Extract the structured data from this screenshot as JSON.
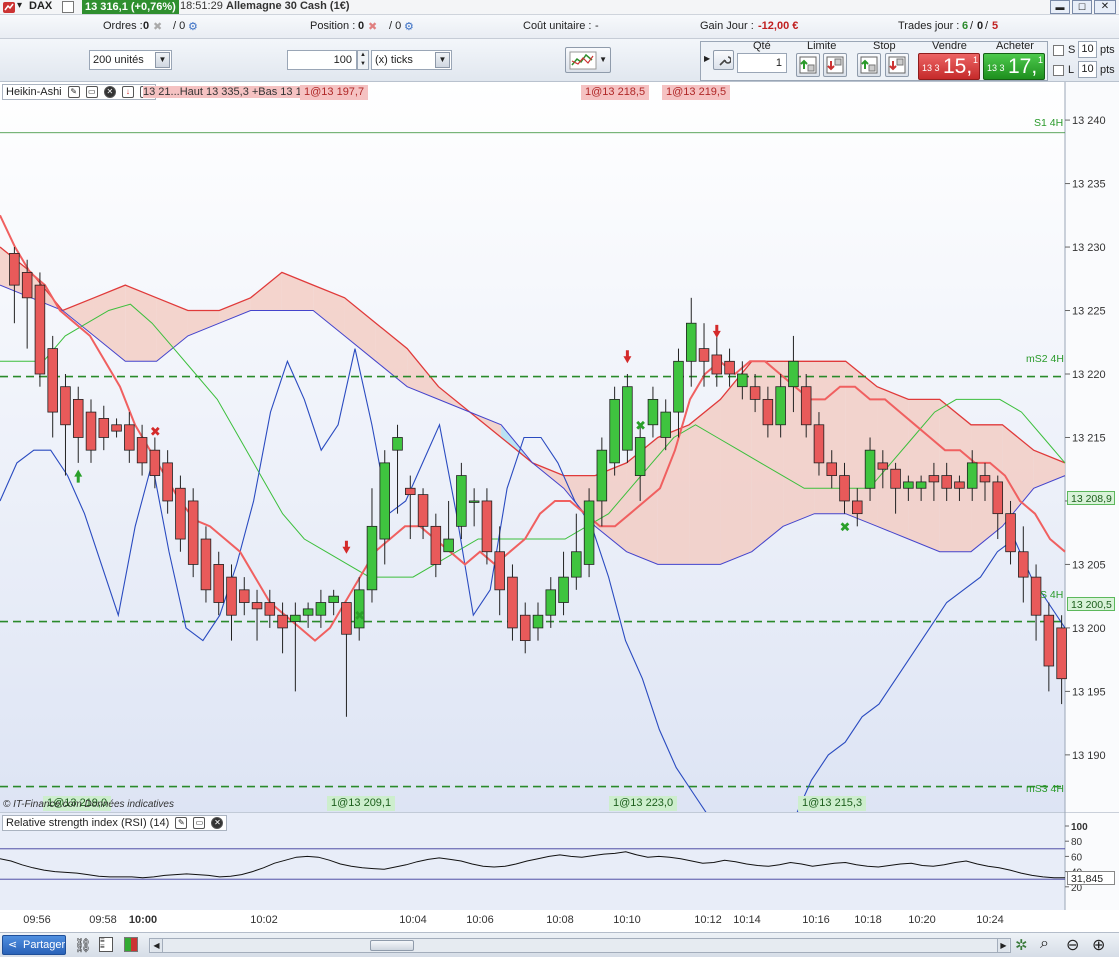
{
  "titlebar": {
    "instrument": "DAX",
    "quote": "13 316,1 (+0,76%)",
    "time": "18:51:29",
    "description": "Allemagne 30 Cash (1€)"
  },
  "infobar": {
    "orders_label": "Ordres :",
    "orders_count": "0",
    "orders_sep": "/ 0",
    "position_label": "Position :",
    "position_count": "0",
    "position_sep": "/ 0",
    "unit_cost_label": "Coût unitaire :",
    "unit_cost_value": "-",
    "day_gain_label": "Gain Jour :",
    "day_gain_value": "-12,00 €",
    "trades_label": "Trades jour :",
    "trades_a": "6",
    "trades_b": "0",
    "trades_c": "5",
    "slash": "/"
  },
  "toolbar": {
    "units_value": "200 unités",
    "ticks_qty": "100",
    "ticks_unit": "(x) ticks",
    "qty_header": "Qté",
    "qty_value": "1",
    "limit_label": "Limite",
    "stop_label": "Stop",
    "sell_label": "Vendre",
    "buy_label": "Acheter",
    "sell_small": "13 3",
    "sell_big": "15,",
    "sell_sup": "1",
    "buy_small": "13 3",
    "buy_big": "17,",
    "buy_sup": "1",
    "s_label": "S",
    "l_label": "L",
    "s_pts": "10",
    "l_pts": "10",
    "pts": "pts"
  },
  "indicator_label": "Heikin-Ashi",
  "legend_text": "13 21...Haut 13 335,3 +Bas 13 164",
  "chart_tags": {
    "top": [
      "1@13 197,7",
      "1@13 218,5",
      "1@13 219,5"
    ],
    "bottom": [
      "1@13 219,0",
      "1@13 209,1",
      "1@13 223,0",
      "1@13 215,3"
    ]
  },
  "level_labels": {
    "s1": "S1 4H",
    "ms2": "mS2 4H",
    "s_mid": "S 4H",
    "ms3": "mS3 4H"
  },
  "price_tags": {
    "p1": "13 208,9",
    "p2": "13 200,5"
  },
  "copyright": "© IT-Finance.com  Données indicatives",
  "rsi": {
    "label": "Relative strength index (RSI) (14)",
    "value_tag": "31,845",
    "levels": [
      "100",
      "80",
      "60",
      "40",
      "20"
    ],
    "values": [
      57,
      54,
      49,
      45,
      42,
      40,
      39,
      38,
      36,
      34,
      33,
      33,
      33,
      32,
      33,
      35,
      36,
      37,
      36,
      35,
      33,
      34,
      36,
      40,
      45,
      51,
      55,
      59,
      60,
      59,
      55,
      50,
      47,
      45,
      44,
      43,
      46,
      49,
      53,
      56,
      58,
      56,
      54,
      50,
      47,
      46,
      47,
      50,
      54,
      57,
      60,
      62,
      60,
      59,
      61,
      63,
      64,
      66,
      62,
      59,
      60,
      59,
      57,
      54,
      51,
      52,
      55,
      53,
      50,
      48,
      47,
      49,
      52,
      50,
      47,
      49,
      51,
      52,
      49,
      47,
      46,
      48,
      50,
      51,
      48,
      47,
      49,
      52,
      54,
      50,
      47,
      45,
      42,
      38,
      35,
      33,
      32,
      32
    ]
  },
  "xaxis": [
    "09:56",
    "09:58",
    "10:00",
    "10:02",
    "10:04",
    "10:06",
    "10:08",
    "10:10",
    "10:12",
    "10:14",
    "10:16",
    "10:18",
    "10:20",
    "10:24"
  ],
  "bottombar": {
    "share_label": "Partager"
  },
  "chart_data": {
    "type": "candlestick",
    "y_ticks": [
      "13 240",
      "13 235",
      "13 230",
      "13 225",
      "13 220",
      "13 215",
      "13 210",
      "13 205",
      "13 200",
      "13 195",
      "13 190"
    ],
    "ylim": [
      13185.5,
      13243
    ],
    "candles": [
      [
        13229.5,
        13227,
        13230,
        13224
      ],
      [
        13228,
        13226,
        13229,
        13222
      ],
      [
        13227,
        13220,
        13228,
        13219
      ],
      [
        13222,
        13217,
        13223,
        13215
      ],
      [
        13219,
        13216,
        13220,
        13212
      ],
      [
        13218,
        13215,
        13219,
        13213
      ],
      [
        13217,
        13214,
        13218,
        13213
      ],
      [
        13216.5,
        13215,
        13217.5,
        13214
      ],
      [
        13216,
        13215.5,
        13216.5,
        13215
      ],
      [
        13216,
        13214,
        13217,
        13213
      ],
      [
        13215,
        13213,
        13216,
        13212
      ],
      [
        13214,
        13212,
        13215,
        13211
      ],
      [
        13213,
        13210,
        13214,
        13209
      ],
      [
        13211,
        13207,
        13212,
        13206
      ],
      [
        13210,
        13205,
        13211,
        13204
      ],
      [
        13207,
        13203,
        13208,
        13202
      ],
      [
        13205,
        13202,
        13206,
        13201
      ],
      [
        13204,
        13201,
        13205,
        13199
      ],
      [
        13203,
        13202,
        13204,
        13201
      ],
      [
        13202,
        13201.5,
        13203,
        13199
      ],
      [
        13202,
        13201,
        13203,
        13200
      ],
      [
        13201,
        13200,
        13202,
        13198
      ],
      [
        13200.5,
        13201,
        13202,
        13195
      ],
      [
        13201,
        13201.5,
        13202,
        13200
      ],
      [
        13201,
        13202,
        13203,
        13200
      ],
      [
        13202,
        13202.5,
        13203,
        13201
      ],
      [
        13202,
        13199.5,
        13202,
        13193
      ],
      [
        13200,
        13203,
        13204,
        13199
      ],
      [
        13203,
        13208,
        13211,
        13202
      ],
      [
        13207,
        13213,
        13214,
        13205
      ],
      [
        13214,
        13215,
        13216,
        13209
      ],
      [
        13211,
        13210.5,
        13212,
        13207
      ],
      [
        13210.5,
        13208,
        13211,
        13207
      ],
      [
        13208,
        13205,
        13209,
        13204
      ],
      [
        13206,
        13207,
        13210,
        13206
      ],
      [
        13208,
        13212,
        13213,
        13207
      ],
      [
        13210,
        13210,
        13211,
        13208
      ],
      [
        13210,
        13206,
        13211,
        13205
      ],
      [
        13206,
        13203,
        13208,
        13201
      ],
      [
        13204,
        13200,
        13205,
        13199
      ],
      [
        13201,
        13199,
        13202,
        13198
      ],
      [
        13200,
        13201,
        13202,
        13199
      ],
      [
        13201,
        13203,
        13204,
        13200
      ],
      [
        13202,
        13204,
        13206,
        13201
      ],
      [
        13204,
        13206,
        13209,
        13203
      ],
      [
        13205,
        13210,
        13211,
        13204
      ],
      [
        13210,
        13214,
        13215,
        13208
      ],
      [
        13213,
        13218,
        13219,
        13212
      ],
      [
        13214,
        13219,
        13220,
        13213
      ],
      [
        13212,
        13215,
        13216,
        13210
      ],
      [
        13216,
        13218,
        13219,
        13215
      ],
      [
        13215,
        13217,
        13218,
        13214
      ],
      [
        13217,
        13221,
        13222,
        13215
      ],
      [
        13221,
        13224,
        13226,
        13219
      ],
      [
        13222,
        13221,
        13224,
        13219
      ],
      [
        13221.5,
        13220,
        13223,
        13219
      ],
      [
        13221,
        13220,
        13222,
        13219
      ],
      [
        13219,
        13220,
        13221,
        13218
      ],
      [
        13219,
        13218,
        13220,
        13217
      ],
      [
        13218,
        13216,
        13219,
        13215
      ],
      [
        13216,
        13219,
        13220,
        13215
      ],
      [
        13219,
        13221,
        13223,
        13217
      ],
      [
        13219,
        13216,
        13220,
        13215
      ],
      [
        13216,
        13213,
        13217,
        13212
      ],
      [
        13213,
        13212,
        13214,
        13211
      ],
      [
        13212,
        13210,
        13213,
        13209
      ],
      [
        13210,
        13209,
        13211,
        13208
      ],
      [
        13211,
        13214,
        13215,
        13210
      ],
      [
        13213,
        13212.5,
        13214,
        13211
      ],
      [
        13212.5,
        13211,
        13213,
        13209
      ],
      [
        13211,
        13211.5,
        13212,
        13210
      ],
      [
        13211,
        13211.5,
        13212,
        13210
      ],
      [
        13212,
        13211.5,
        13213,
        13210
      ],
      [
        13212,
        13211,
        13213,
        13210
      ],
      [
        13211.5,
        13211,
        13212,
        13210
      ],
      [
        13211,
        13213,
        13214,
        13210
      ],
      [
        13212,
        13211.5,
        13213,
        13210
      ],
      [
        13211.5,
        13209,
        13212,
        13207
      ],
      [
        13209,
        13206,
        13210,
        13205
      ],
      [
        13206,
        13204,
        13208,
        13202
      ],
      [
        13204,
        13201,
        13205,
        13199
      ],
      [
        13201,
        13197,
        13202,
        13195
      ],
      [
        13200,
        13196,
        13201,
        13194
      ]
    ],
    "line_red": [
      13232.5,
      13230,
      13228,
      13227,
      13225,
      13224,
      13223,
      13221,
      13219,
      13216,
      13214,
      13212,
      13210,
      13208.5,
      13208,
      13207,
      13206,
      13204,
      13202,
      13201,
      13200,
      13199,
      13200,
      13202,
      13204,
      13206,
      13207,
      13208,
      13208,
      13207,
      13206,
      13205,
      13206,
      13205,
      13206,
      13207,
      13209,
      13210,
      13210,
      13209,
      13208,
      13208,
      13209,
      13210,
      13211,
      13214,
      13218,
      13220,
      13221,
      13220,
      13221,
      13221,
      13220,
      13219,
      13218,
      13218,
      13219,
      13219,
      13218,
      13218,
      13217,
      13216,
      13215,
      13214,
      13214,
      13213,
      13213,
      13212,
      13210,
      13209,
      13207,
      13206
    ],
    "line_blue": [
      13210,
      13213,
      13214,
      13214,
      13212,
      13209,
      13205,
      13201,
      13208,
      13213,
      13206,
      13200,
      13199,
      13201,
      13205,
      13210,
      13217,
      13221,
      13218,
      13214,
      13216,
      13222,
      13216,
      13209,
      13210,
      13213,
      13216,
      13209,
      13201,
      13203,
      13211,
      13215,
      13215,
      13213,
      13210,
      13208,
      13204,
      13199,
      13196,
      13192,
      13189,
      13187,
      13185,
      13183,
      13182,
      13182,
      13183,
      13185,
      13188,
      13190,
      13191,
      13193,
      13194,
      13196,
      13198,
      13200,
      13202,
      13203,
      13204,
      13206,
      13207,
      13204,
      13202,
      13200
    ],
    "line_green_a": [
      13221,
      13221,
      13221,
      13223,
      13224,
      13225,
      13225.5,
      13224,
      13222,
      13220,
      13218,
      13215,
      13212,
      13209,
      13207,
      13206,
      13205,
      13204,
      13204,
      13204,
      13205,
      13206,
      13207,
      13207,
      13207,
      13207,
      13207,
      13208,
      13209,
      13211,
      13213,
      13215,
      13216,
      13215,
      13214,
      13213,
      13212,
      13211,
      13211,
      13211,
      13211,
      13213,
      13215,
      13217,
      13218,
      13218,
      13218,
      13217,
      13215,
      13213
    ],
    "cloud_top": [
      13230,
      13228,
      13225,
      13226,
      13227,
      13226,
      13225,
      13225,
      13226,
      13228,
      13227,
      13226,
      13224,
      13222,
      13219,
      13217,
      13215,
      13213,
      13212,
      13212,
      13213,
      13215,
      13216,
      13218,
      13221,
      13221,
      13221,
      13221,
      13219,
      13218,
      13218,
      13216,
      13216,
      13214,
      13213
    ],
    "cloud_bottom": [
      13227,
      13226,
      13225,
      13223,
      13221,
      13221,
      13223,
      13224,
      13225,
      13225,
      13225,
      13223,
      13221,
      13219,
      13218,
      13217,
      13216,
      13213,
      13211,
      13208,
      13206,
      13205,
      13205,
      13205,
      13206,
      13208,
      13209,
      13209,
      13208,
      13207,
      13206,
      13206,
      13208,
      13211,
      13212
    ],
    "levels": [
      {
        "label": "S1 4H",
        "price": 13239
      },
      {
        "label": "mS2 4H",
        "price": 13219.8
      },
      {
        "label": "S 4H",
        "price": 13200.5
      },
      {
        "label": "mS3 4H",
        "price": 13187.5
      }
    ]
  }
}
